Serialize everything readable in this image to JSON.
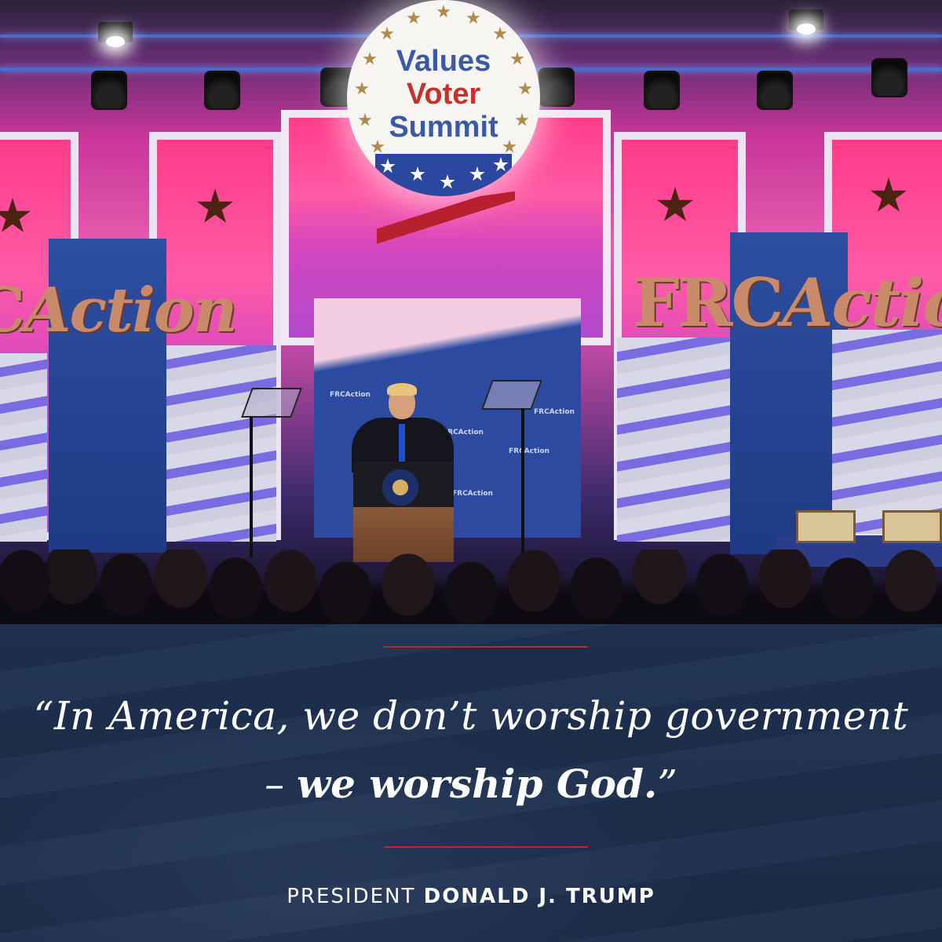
{
  "photo": {
    "emblem": {
      "line1": "Values",
      "line2": "Voter",
      "line3": "Summit"
    },
    "backdrop_brand": "FRCAction",
    "colors": {
      "emblem_blue": "#3a5aa8",
      "emblem_red": "#c8302c",
      "stage_pink": "#ff4fa3",
      "stage_blue": "#2b4aa0"
    }
  },
  "quote": {
    "line1": "“In America, we don’t worship government",
    "line2_prefix": "– ",
    "line2_emphasis": "we worship God.",
    "line2_suffix": "”"
  },
  "attribution": {
    "title": "PRESIDENT",
    "name": "DONALD J. TRUMP"
  },
  "colors": {
    "banner": "#1b2b45",
    "rule": "#c2242f",
    "text": "#ffffff"
  }
}
